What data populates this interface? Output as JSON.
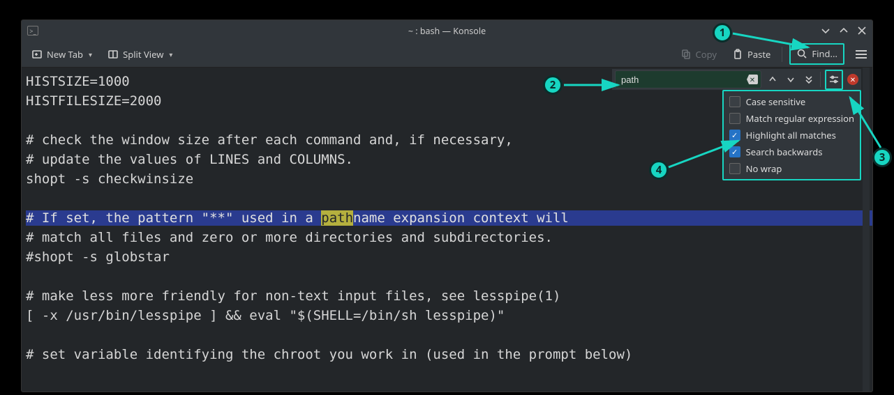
{
  "window": {
    "title": "~ : bash — Konsole"
  },
  "toolbar": {
    "new_tab": "New Tab",
    "split_view": "Split View",
    "copy": "Copy",
    "paste": "Paste",
    "find": "Find..."
  },
  "search": {
    "value": "path",
    "options": {
      "case_sensitive": {
        "label": "Case sensitive",
        "checked": false
      },
      "regex": {
        "label": "Match regular expression",
        "checked": false
      },
      "highlight_all": {
        "label": "Highlight all matches",
        "checked": true
      },
      "backwards": {
        "label": "Search backwards",
        "checked": true
      },
      "no_wrap": {
        "label": "No wrap",
        "checked": false
      }
    }
  },
  "terminal": {
    "lines": [
      {
        "text": "HISTSIZE=1000"
      },
      {
        "text": "HISTFILESIZE=2000"
      },
      {
        "text": ""
      },
      {
        "text": "# check the window size after each command and, if necessary,"
      },
      {
        "text": "# update the values of LINES and COLUMNS."
      },
      {
        "text": "shopt -s checkwinsize"
      },
      {
        "text": ""
      },
      {
        "selected": true,
        "pre": "# If set, the pattern \"**\" used in a ",
        "match": "path",
        "post": "name expansion context will"
      },
      {
        "text": "# match all files and zero or more directories and subdirectories."
      },
      {
        "text": "#shopt -s globstar"
      },
      {
        "text": ""
      },
      {
        "text": "# make less more friendly for non-text input files, see lesspipe(1)"
      },
      {
        "text": "[ -x /usr/bin/lesspipe ] && eval \"$(SHELL=/bin/sh lesspipe)\""
      },
      {
        "text": ""
      },
      {
        "text": "# set variable identifying the chroot you work in (used in the prompt below)"
      }
    ]
  },
  "annotations": {
    "1": "1",
    "2": "2",
    "3": "3",
    "4": "4"
  }
}
